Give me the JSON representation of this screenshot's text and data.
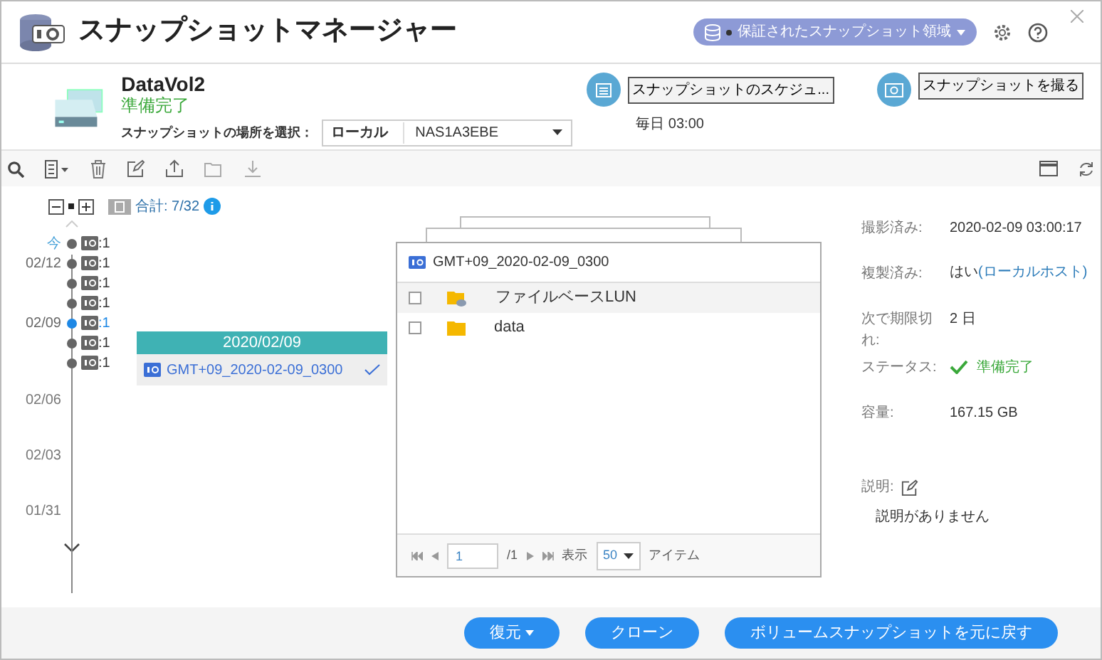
{
  "window": {
    "title": "スナップショットマネージャー"
  },
  "header_menu": {
    "label": "保証されたスナップショット領域"
  },
  "volume": {
    "name": "DataVol2",
    "status": "準備完了",
    "location_label": "スナップショットの場所を選択：",
    "location_type": "ローカル",
    "location_nas": "NAS1A3EBE",
    "schedule_button": "スナップショットのスケジュ...",
    "schedule_text": "毎日 03:00",
    "take_button": "スナップショットを撮る"
  },
  "tree_controls": {
    "total": "合計: 7/32"
  },
  "timeline": {
    "items": [
      {
        "date_label": "今",
        "count": ":1",
        "selected": false
      },
      {
        "date_label": "02/12",
        "count": ":1",
        "selected": false
      },
      {
        "count": ":1",
        "selected": false
      },
      {
        "count": ":1",
        "selected": false
      },
      {
        "date_label": "02/09",
        "count": ":1",
        "selected": true
      },
      {
        "count": ":1",
        "selected": false
      },
      {
        "count": ":1",
        "selected": false
      }
    ],
    "axis_labels": [
      "02/06",
      "02/03",
      "01/31"
    ]
  },
  "popup": {
    "date": "2020/02/09",
    "snapshot": {
      "name": "GMT+09_2020-02-09_0300",
      "selected": true
    }
  },
  "file_panel": {
    "title": "GMT+09_2020-02-09_0300",
    "rows": [
      {
        "name": "ファイルベースLUN",
        "kind": "lun",
        "checked": false
      },
      {
        "name": "data",
        "kind": "folder",
        "checked": false
      }
    ],
    "pagination": {
      "page": "1",
      "total": "/1",
      "show_label": "表示",
      "per_page": "50",
      "items_label": "アイテム"
    }
  },
  "details": {
    "rows": [
      {
        "label": "撮影済み:",
        "value": "2020-02-09 03:00:17",
        "kind": "text"
      },
      {
        "label": "複製済み:",
        "value": "はい",
        "link": "(ローカルホスト)",
        "kind": "link"
      },
      {
        "label": "次で期限切れ:",
        "value": "2 日",
        "kind": "text"
      },
      {
        "label": "ステータス:",
        "value": "準備完了",
        "kind": "status"
      },
      {
        "label": "容量:",
        "value": "167.15 GB",
        "kind": "text"
      }
    ],
    "description_label": "説明:",
    "description": "説明がありません"
  },
  "footer_buttons": [
    {
      "label": "復元",
      "dropdown": true
    },
    {
      "label": "クローン",
      "dropdown": false
    },
    {
      "label": "ボリュームスナップショットを元に戻す",
      "dropdown": false
    }
  ]
}
